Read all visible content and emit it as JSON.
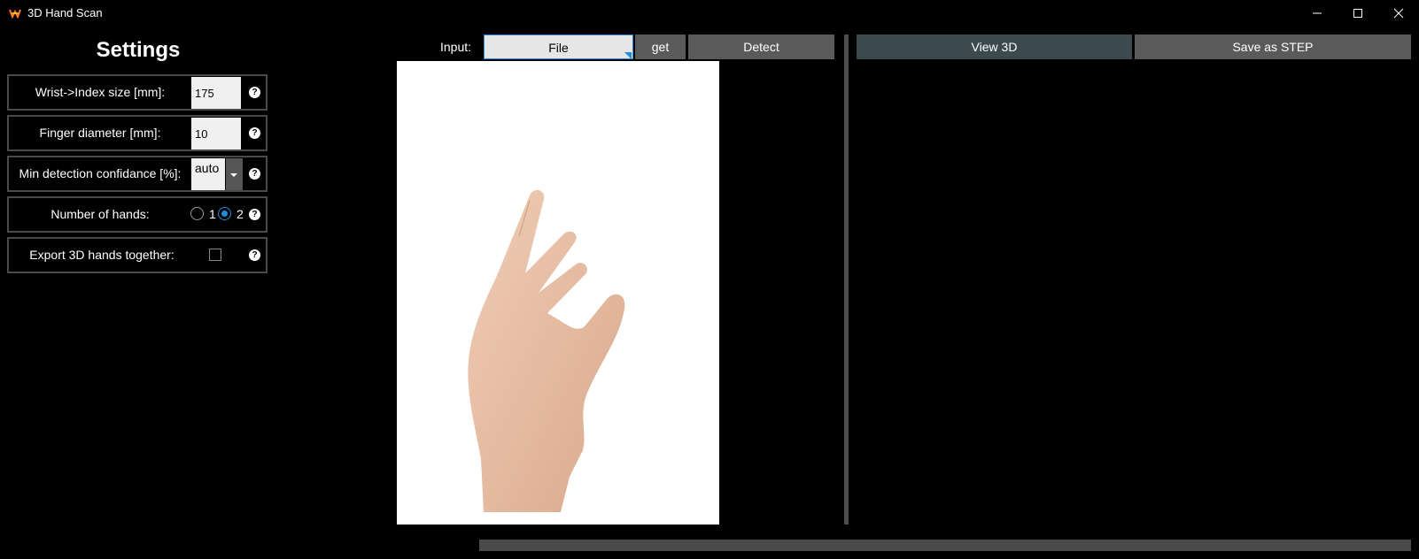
{
  "window": {
    "title": "3D Hand Scan",
    "icon": "app-logo-icon",
    "controls": [
      "minimize-icon",
      "maximize-icon",
      "close-icon"
    ]
  },
  "settings": {
    "title": "Settings",
    "wrist_index": {
      "label": "Wrist->Index size [mm]:",
      "value": "175"
    },
    "finger_diameter": {
      "label": "Finger diameter [mm]:",
      "value": "10"
    },
    "min_confidence": {
      "label": "Min detection confidance [%]:",
      "value": "auto"
    },
    "hands": {
      "label": "Number of hands:",
      "options": [
        "1",
        "2"
      ],
      "selected": "2"
    },
    "export_together": {
      "label": "Export 3D hands together:",
      "checked": false
    },
    "help_glyph": "?"
  },
  "toolbar": {
    "input_label": "Input:",
    "file_label": "File",
    "get_label": "get",
    "detect_label": "Detect",
    "view3d_label": "View 3D",
    "save_step_label": "Save as STEP"
  },
  "colors": {
    "background": "#000000",
    "accent": "#1f8ed8",
    "button": "#5a5a5a",
    "view3d_button": "#3c4a50"
  }
}
